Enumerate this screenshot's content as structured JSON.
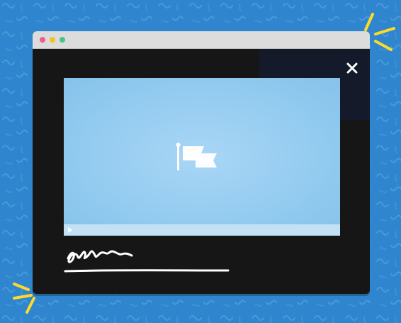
{
  "colors": {
    "background": "#2f86cf",
    "pattern": "#4a9ad9",
    "spark": "#ffd92a",
    "window_frame": "#121212",
    "titlebar": "#dcdcdc",
    "player_bg": "#93cbf0",
    "player_bar": "#c3e1f5",
    "ink": "#ffffff"
  },
  "titlebar": {
    "controls": [
      {
        "name": "close-dot",
        "color": "#f05d8a"
      },
      {
        "name": "minimize-dot",
        "color": "#f5c21b"
      },
      {
        "name": "maximize-dot",
        "color": "#4cc38a"
      }
    ]
  },
  "icons": {
    "close": "close-icon",
    "center_logo": "flag-logo-icon",
    "play": "play-icon"
  },
  "player": {
    "progress": 0
  }
}
